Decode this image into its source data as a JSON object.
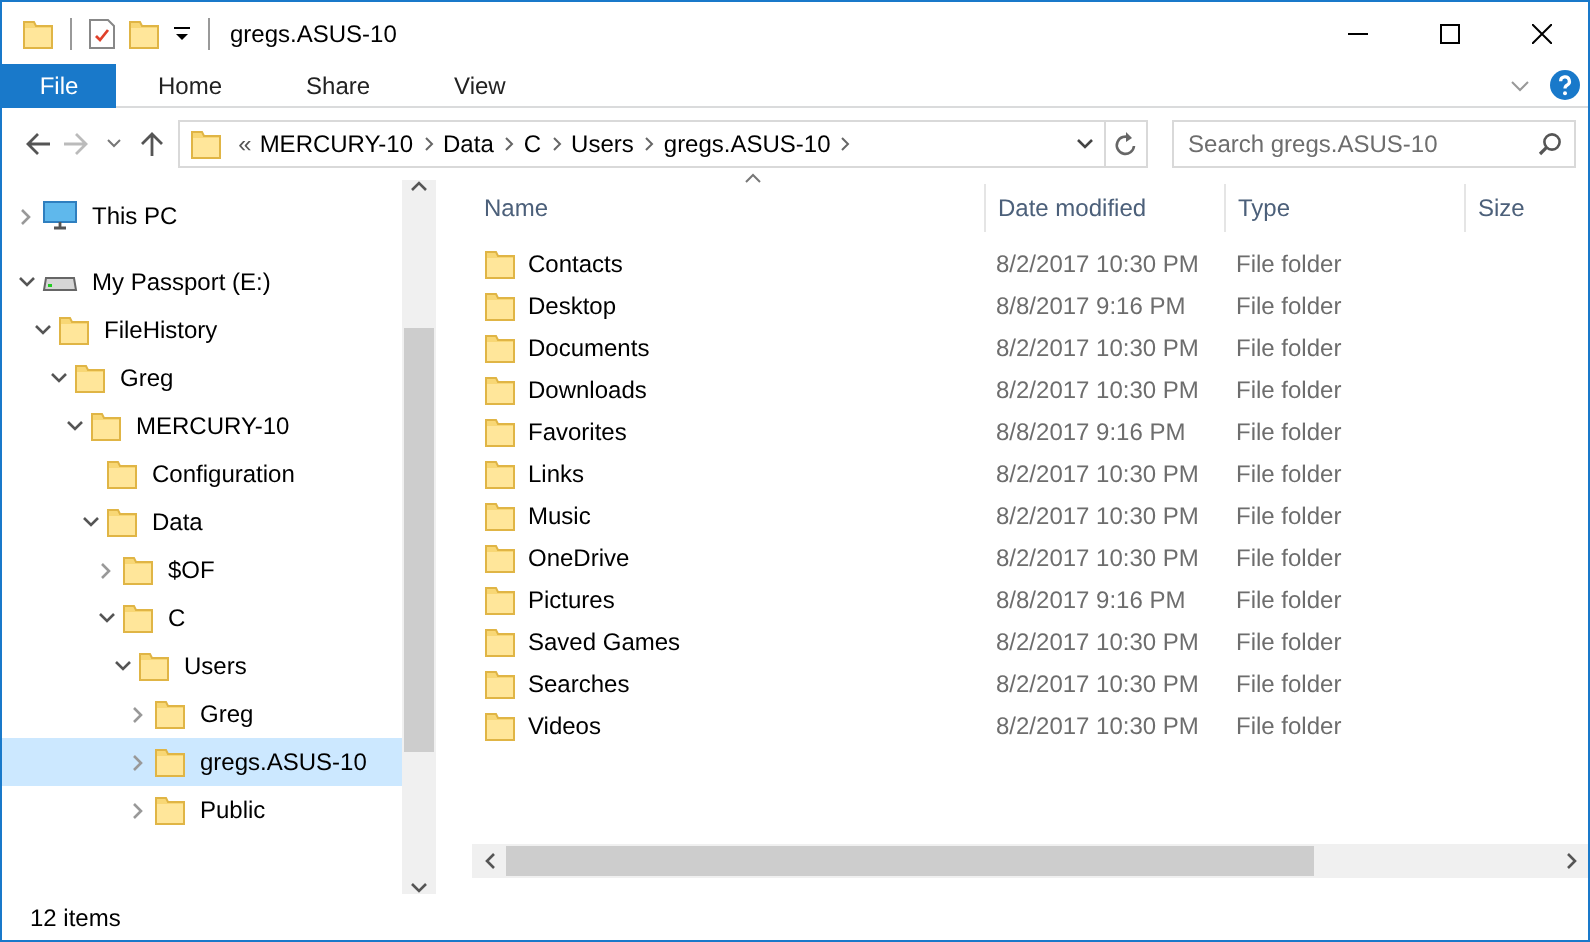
{
  "window": {
    "title": "gregs.ASUS-10"
  },
  "ribbon_tabs": [
    {
      "label": "File",
      "kind": "file",
      "selected": false
    },
    {
      "label": "Home",
      "kind": "tab",
      "selected": false
    },
    {
      "label": "Share",
      "kind": "tab",
      "selected": false
    },
    {
      "label": "View",
      "kind": "tab",
      "selected": false
    }
  ],
  "address_bar": {
    "overflow": "«",
    "crumbs": [
      "MERCURY-10",
      "Data",
      "C",
      "Users",
      "gregs.ASUS-10"
    ]
  },
  "search": {
    "placeholder": "Search gregs.ASUS-10"
  },
  "navigation": [
    {
      "label": "This PC",
      "kind": "pc",
      "expandable": true,
      "expanded": false,
      "selected": false
    },
    {
      "label": "My Passport (E:)",
      "kind": "drive",
      "expandable": true,
      "expanded": true,
      "selected": false,
      "children": [
        {
          "label": "FileHistory",
          "kind": "folder",
          "expandable": true,
          "expanded": true,
          "selected": false,
          "children": [
            {
              "label": "Greg",
              "kind": "folder",
              "expandable": true,
              "expanded": true,
              "selected": false,
              "children": [
                {
                  "label": "MERCURY-10",
                  "kind": "folder",
                  "expandable": true,
                  "expanded": true,
                  "selected": false,
                  "children": [
                    {
                      "label": "Configuration",
                      "kind": "folder",
                      "expandable": false,
                      "selected": false
                    },
                    {
                      "label": "Data",
                      "kind": "folder",
                      "expandable": true,
                      "expanded": true,
                      "selected": false,
                      "children": [
                        {
                          "label": "$OF",
                          "kind": "folder",
                          "expandable": true,
                          "expanded": false,
                          "selected": false
                        },
                        {
                          "label": "C",
                          "kind": "folder",
                          "expandable": true,
                          "expanded": true,
                          "selected": false,
                          "children": [
                            {
                              "label": "Users",
                              "kind": "folder",
                              "expandable": true,
                              "expanded": true,
                              "selected": false,
                              "children": [
                                {
                                  "label": "Greg",
                                  "kind": "folder",
                                  "expandable": true,
                                  "expanded": false,
                                  "selected": false
                                },
                                {
                                  "label": "gregs.ASUS-10",
                                  "kind": "folder",
                                  "expandable": true,
                                  "expanded": false,
                                  "selected": true
                                },
                                {
                                  "label": "Public",
                                  "kind": "folder",
                                  "expandable": true,
                                  "expanded": false,
                                  "selected": false
                                }
                              ]
                            }
                          ]
                        }
                      ]
                    }
                  ]
                }
              ]
            }
          ]
        }
      ]
    }
  ],
  "file_list": {
    "columns": [
      "Name",
      "Date modified",
      "Type",
      "Size"
    ],
    "rows": [
      [
        "Contacts",
        "8/2/2017 10:30 PM",
        "File folder"
      ],
      [
        "Desktop",
        "8/8/2017 9:16 PM",
        "File folder"
      ],
      [
        "Documents",
        "8/2/2017 10:30 PM",
        "File folder"
      ],
      [
        "Downloads",
        "8/2/2017 10:30 PM",
        "File folder"
      ],
      [
        "Favorites",
        "8/8/2017 9:16 PM",
        "File folder"
      ],
      [
        "Links",
        "8/2/2017 10:30 PM",
        "File folder"
      ],
      [
        "Music",
        "8/2/2017 10:30 PM",
        "File folder"
      ],
      [
        "OneDrive",
        "8/2/2017 10:30 PM",
        "File folder"
      ],
      [
        "Pictures",
        "8/8/2017 9:16 PM",
        "File folder"
      ],
      [
        "Saved Games",
        "8/2/2017 10:30 PM",
        "File folder"
      ],
      [
        "Searches",
        "8/2/2017 10:30 PM",
        "File folder"
      ],
      [
        "Videos",
        "8/2/2017 10:30 PM",
        "File folder"
      ]
    ]
  },
  "status_bar": {
    "text": "12 items"
  }
}
